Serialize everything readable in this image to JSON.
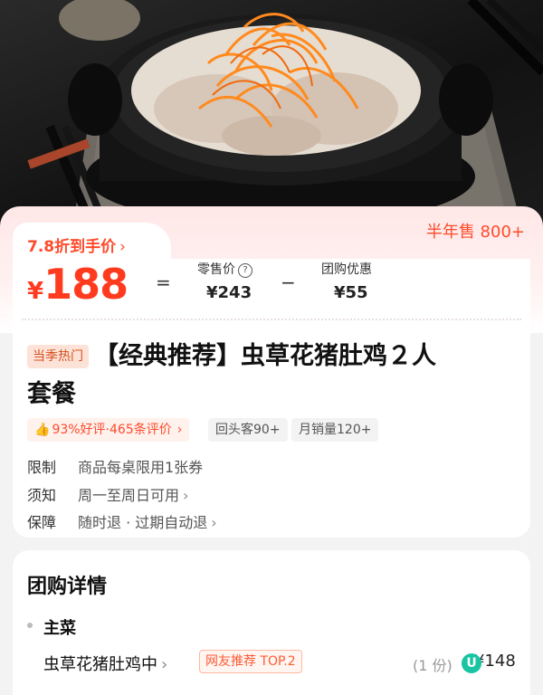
{
  "price_panel": {
    "discount_label": "7.8折到手价",
    "half_year_sales": "半年售 800+",
    "currency": "¥",
    "final_price": "188",
    "equals": "=",
    "minus": "−",
    "retail_label": "零售价",
    "retail_price": "¥243",
    "group_label": "团购优惠",
    "group_discount": "¥55"
  },
  "product": {
    "season_tag": "当季热门",
    "title_line1": "【经典推荐】虫草花猪肚鸡２人",
    "title_line2": "套餐",
    "rating": "93%好评·465条评价",
    "repeat_customers": "回头客90+",
    "monthly_sales": "月销量120+"
  },
  "info_rows": [
    {
      "key": "限制",
      "value": "商品每桌限用1张券"
    },
    {
      "key": "须知",
      "value": "周一至周日可用"
    },
    {
      "key": "保障",
      "value": "随时退 · 过期自动退"
    }
  ],
  "details": {
    "title": "团购详情",
    "section": "主菜",
    "dish_name": "虫草花猪肚鸡中",
    "dish_tag": "网友推荐 TOP.2",
    "dish_qty": "(1 份)",
    "dish_price": "¥148"
  },
  "colors": {
    "accent": "#ff4b2b",
    "pink_bg": "#ffe7e7",
    "teal_badge": "#19c4a3"
  }
}
